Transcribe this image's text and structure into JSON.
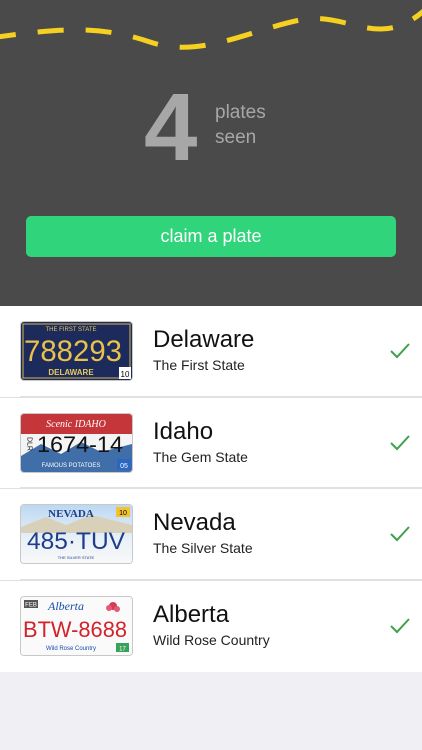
{
  "header": {
    "count": "4",
    "count_label_line1": "plates",
    "count_label_line2": "seen",
    "claim_button": "claim a plate",
    "road_dash_color": "#f5d020",
    "button_color": "#2fd47b"
  },
  "plates": [
    {
      "state": "Delaware",
      "nickname": "The First State",
      "plate_number": "788293",
      "plate_top_text": "THE FIRST STATE",
      "plate_bottom_text": "DELAWARE",
      "plate_sticker": "10",
      "seen": true
    },
    {
      "state": "Idaho",
      "nickname": "The Gem State",
      "plate_number": "1674-14",
      "plate_top_text": "Scenic IDAHO",
      "plate_bottom_text": "FAMOUS POTATOES",
      "plate_side_text": "DLR",
      "plate_sticker": "05",
      "seen": true
    },
    {
      "state": "Nevada",
      "nickname": "The Silver State",
      "plate_number": "485·TUV",
      "plate_top_text": "NEVADA",
      "plate_bottom_text": "THE SILVER STATE",
      "plate_sticker": "10",
      "seen": true
    },
    {
      "state": "Alberta",
      "nickname": "Wild Rose Country",
      "plate_number": "BTW-8688",
      "plate_top_text": "Alberta",
      "plate_month": "FEB",
      "plate_bottom_text": "Wild Rose Country",
      "plate_sticker": "17",
      "seen": true
    }
  ]
}
